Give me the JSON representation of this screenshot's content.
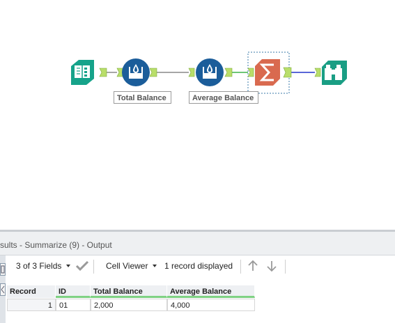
{
  "workflow": {
    "tools": [
      {
        "name": "input-data",
        "icon": "book-icon"
      },
      {
        "name": "formula-total-balance",
        "icon": "beaker-icon",
        "label": "Total Balance"
      },
      {
        "name": "formula-average-balance",
        "icon": "beaker-icon",
        "label": "Average Balance"
      },
      {
        "name": "summarize",
        "icon": "sigma-icon",
        "selected": true
      },
      {
        "name": "browse",
        "icon": "binoculars-icon"
      }
    ],
    "colors": {
      "input_teal": "#16a38a",
      "formula_blue": "#1b5d9a",
      "summarize_orange": "#d96a4f",
      "browse_teal": "#1a9e84",
      "anchor_green": "#b9de6a",
      "connector_gray": "#888888",
      "connector_green": "#3db34a",
      "connector_blue": "#2233cc"
    }
  },
  "results": {
    "title": "sults - Summarize (9) - Output",
    "toolbar": {
      "fields_label": "3 of 3 Fields",
      "cell_viewer_label": "Cell Viewer",
      "records_label": "1 record displayed"
    },
    "columns": [
      "Record",
      "ID",
      "Total Balance",
      "Average Balance"
    ],
    "rows": [
      {
        "record": "1",
        "id": "01",
        "total_balance": "2,000",
        "average_balance": "4,000"
      }
    ]
  }
}
